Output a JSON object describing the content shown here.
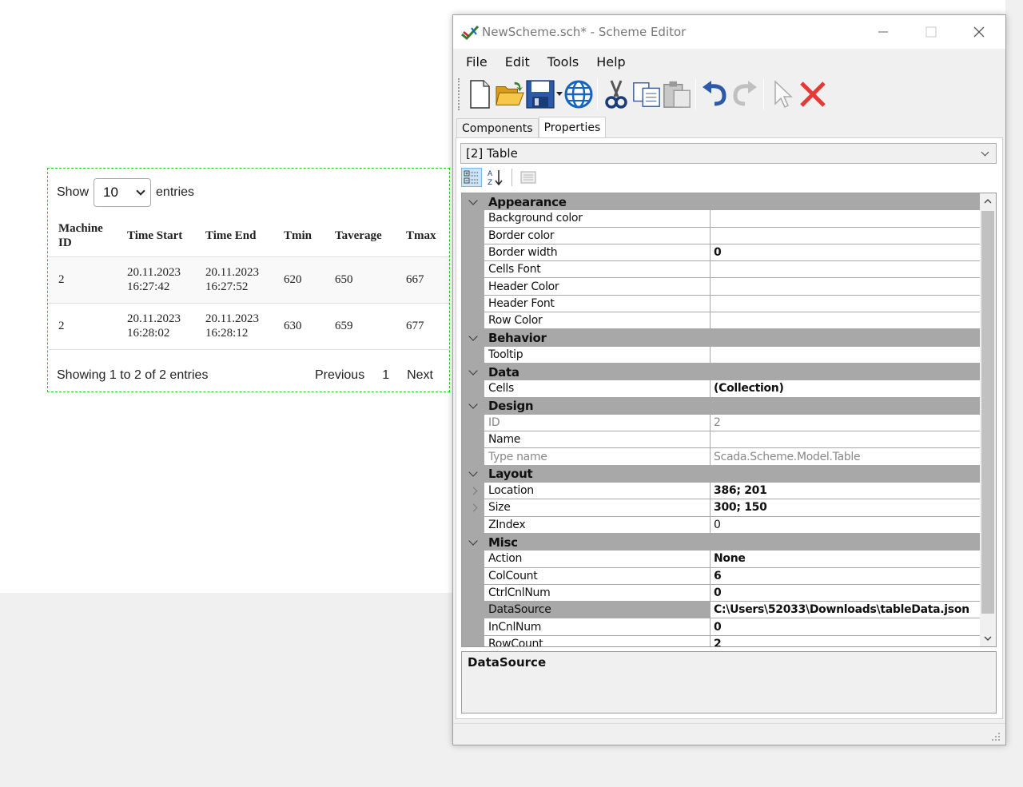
{
  "table_widget": {
    "show_label": "Show",
    "page_size": "10",
    "entries_label": "entries",
    "columns": [
      "Machine ID",
      "Time Start",
      "Time End",
      "Tmin",
      "Taverage",
      "Tmax"
    ],
    "rows": [
      [
        "2",
        "20.11.2023 16:27:42",
        "20.11.2023 16:27:52",
        "620",
        "650",
        "667"
      ],
      [
        "2",
        "20.11.2023 16:28:02",
        "20.11.2023 16:28:12",
        "630",
        "659",
        "677"
      ]
    ],
    "info": "Showing 1 to 2 of 2 entries",
    "previous": "Previous",
    "page": "1",
    "next": "Next"
  },
  "editor": {
    "title": "NewScheme.sch* - Scheme Editor",
    "menu": [
      "File",
      "Edit",
      "Tools",
      "Help"
    ],
    "toolbar": [
      "new-icon",
      "open-icon",
      "save-icon",
      "web-icon",
      "cut-icon",
      "copy-icon",
      "paste-icon",
      "undo-icon",
      "redo-icon",
      "pointer-icon",
      "delete-icon"
    ],
    "tabs": [
      "Components",
      "Properties"
    ],
    "selected_object": "[2] Table",
    "property_grid": {
      "categories": [
        {
          "name": "Appearance",
          "props": [
            {
              "name": "Background color",
              "value": ""
            },
            {
              "name": "Border color",
              "value": ""
            },
            {
              "name": "Border width",
              "value": "0",
              "bold": true
            },
            {
              "name": "Cells Font",
              "value": ""
            },
            {
              "name": "Header Color",
              "value": ""
            },
            {
              "name": "Header Font",
              "value": ""
            },
            {
              "name": "Row Color",
              "value": ""
            }
          ]
        },
        {
          "name": "Behavior",
          "props": [
            {
              "name": "Tooltip",
              "value": ""
            }
          ]
        },
        {
          "name": "Data",
          "props": [
            {
              "name": "Cells",
              "value": "(Collection)",
              "bold": true
            }
          ]
        },
        {
          "name": "Design",
          "props": [
            {
              "name": "ID",
              "value": "2",
              "readonly": true
            },
            {
              "name": "Name",
              "value": ""
            },
            {
              "name": "Type name",
              "value": "Scada.Scheme.Model.Table",
              "readonly": true
            }
          ]
        },
        {
          "name": "Layout",
          "props": [
            {
              "name": "Location",
              "value": "386; 201",
              "bold": true,
              "expandable": true
            },
            {
              "name": "Size",
              "value": "300; 150",
              "bold": true,
              "expandable": true
            },
            {
              "name": "ZIndex",
              "value": "0"
            }
          ]
        },
        {
          "name": "Misc",
          "props": [
            {
              "name": "Action",
              "value": "None",
              "bold": true
            },
            {
              "name": "ColCount",
              "value": "6",
              "bold": true
            },
            {
              "name": "CtrlCnlNum",
              "value": "0",
              "bold": true
            },
            {
              "name": "DataSource",
              "value": "C:\\Users\\52033\\Downloads\\tableData.json",
              "bold": true,
              "selected": true
            },
            {
              "name": "InCnlNum",
              "value": "0",
              "bold": true
            },
            {
              "name": "RowCount",
              "value": "2",
              "bold": true
            }
          ]
        }
      ]
    },
    "description_title": "DataSource"
  }
}
